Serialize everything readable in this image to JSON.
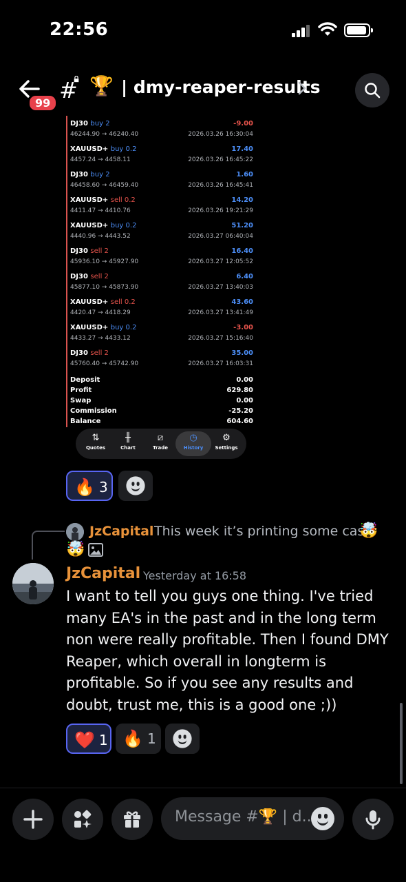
{
  "status_bar": {
    "time": "22:56",
    "icons": [
      "cellular-signal-icon",
      "wifi-icon",
      "battery-icon"
    ]
  },
  "header": {
    "back_icon": "arrow-left-icon",
    "unread_badge": "99",
    "channel_icon": "hash-lock-icon",
    "channel_emoji": "🏆",
    "channel_name": "| dmy-reaper-results",
    "chevron_icon": "chevron-right-icon",
    "search_icon": "search-icon"
  },
  "attachment": {
    "trades": [
      {
        "symbol": "DJ30",
        "side": "buy 2",
        "type": "buy",
        "prices": "46244.90 → 46240.40",
        "profit": "-9.00",
        "sign": "neg",
        "date": "2026.03.26 16:30:04"
      },
      {
        "symbol": "XAUUSD+",
        "side": "buy 0.2",
        "type": "buy",
        "prices": "4457.24 → 4458.11",
        "profit": "17.40",
        "sign": "pos",
        "date": "2026.03.26 16:45:22"
      },
      {
        "symbol": "DJ30",
        "side": "buy 2",
        "type": "buy",
        "prices": "46458.60 → 46459.40",
        "profit": "1.60",
        "sign": "pos",
        "date": "2026.03.26 16:45:41"
      },
      {
        "symbol": "XAUUSD+",
        "side": "sell 0.2",
        "type": "sell",
        "prices": "4411.47 → 4410.76",
        "profit": "14.20",
        "sign": "pos",
        "date": "2026.03.26 19:21:29"
      },
      {
        "symbol": "XAUUSD+",
        "side": "buy 0.2",
        "type": "buy",
        "prices": "4440.96 → 4443.52",
        "profit": "51.20",
        "sign": "pos",
        "date": "2026.03.27 06:40:04"
      },
      {
        "symbol": "DJ30",
        "side": "sell 2",
        "type": "sell",
        "prices": "45936.10 → 45927.90",
        "profit": "16.40",
        "sign": "pos",
        "date": "2026.03.27 12:05:52"
      },
      {
        "symbol": "DJ30",
        "side": "sell 2",
        "type": "sell",
        "prices": "45877.10 → 45873.90",
        "profit": "6.40",
        "sign": "pos",
        "date": "2026.03.27 13:40:03"
      },
      {
        "symbol": "XAUUSD+",
        "side": "sell 0.2",
        "type": "sell",
        "prices": "4420.47 → 4418.29",
        "profit": "43.60",
        "sign": "pos",
        "date": "2026.03.27 13:41:49"
      },
      {
        "symbol": "XAUUSD+",
        "side": "buy 0.2",
        "type": "buy",
        "prices": "4433.27 → 4433.12",
        "profit": "-3.00",
        "sign": "neg",
        "date": "2026.03.27 15:16:40"
      },
      {
        "symbol": "DJ30",
        "side": "sell 2",
        "type": "sell",
        "prices": "45760.40 → 45742.90",
        "profit": "35.00",
        "sign": "pos",
        "date": "2026.03.27 16:03:31"
      }
    ],
    "summary": [
      {
        "label": "Deposit",
        "value": "0.00"
      },
      {
        "label": "Profit",
        "value": "629.80"
      },
      {
        "label": "Swap",
        "value": "0.00"
      },
      {
        "label": "Commission",
        "value": "-25.20"
      },
      {
        "label": "Balance",
        "value": "604.60"
      }
    ],
    "tabs": [
      {
        "label": "Quotes",
        "icon": "quotes-arrows-icon"
      },
      {
        "label": "Chart",
        "icon": "candlestick-icon"
      },
      {
        "label": "Trade",
        "icon": "trend-chart-icon"
      },
      {
        "label": "History",
        "icon": "history-clock-icon",
        "active": true
      },
      {
        "label": "Settings",
        "icon": "gear-icon"
      }
    ]
  },
  "reactions_top": [
    {
      "emoji": "🔥",
      "count": "3",
      "active": true
    },
    {
      "emoji": "add-reaction-icon",
      "count": ""
    }
  ],
  "reply": {
    "author": "JzCapital",
    "text": "This week it’s printing some cash",
    "emoji": "🤯",
    "emoji_second": "🤯",
    "image_icon": "image-icon"
  },
  "message": {
    "author": "JzCapital",
    "timestamp": "Yesterday at 16:58",
    "text": "I want to tell you guys one thing. I've tried many EA's in the past and in the long term non were really profitable. Then I found DMY Reaper, which overall in longterm is profitable. So if you see any results and doubt, trust me, this is a good one ;))"
  },
  "reactions_bottom": [
    {
      "emoji": "❤️",
      "count": "1",
      "active": true
    },
    {
      "emoji": "🔥",
      "count": "1",
      "active": false
    },
    {
      "emoji": "add-reaction-icon",
      "count": ""
    }
  ],
  "composer": {
    "placeholder": "Message #🏆 | d..",
    "buttons": [
      "plus-icon",
      "apps-icon",
      "gift-icon",
      "emoji-icon",
      "microphone-icon"
    ]
  },
  "colors": {
    "accent": "#5865f2",
    "author": "#e8923a",
    "buy": "#4c8ef7",
    "sell": "#e5534b",
    "badge": "#e8414b"
  }
}
